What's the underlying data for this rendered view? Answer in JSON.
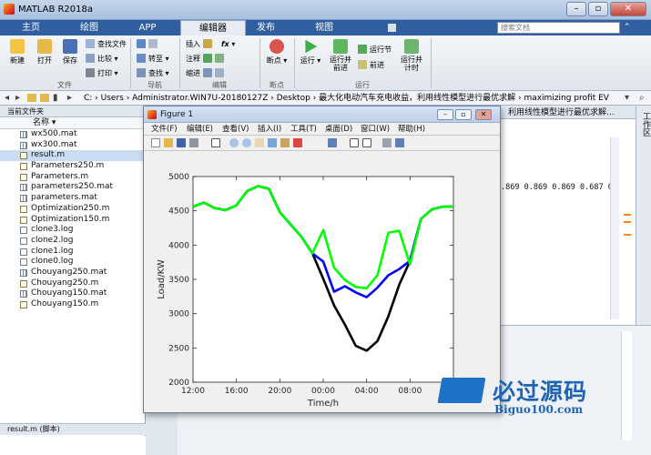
{
  "window": {
    "title": "MATLAB R2018a"
  },
  "tabs": [
    "主页",
    "绘图",
    "APP",
    "编辑器",
    "发布",
    "视图"
  ],
  "search": {
    "placeholder": "搜索文档"
  },
  "ribbon": {
    "file": {
      "new": "新建",
      "open": "打开",
      "save": "保存",
      "find_files": "查找文件",
      "compare": "比较",
      "print": "打印",
      "group": "文件"
    },
    "navigate": {
      "goto": "转至",
      "find": "查找",
      "group": "导航"
    },
    "edit": {
      "insert": "插入",
      "comment": "注释",
      "indent": "缩进",
      "fx": "fx",
      "group": "编辑"
    },
    "breakpoints": {
      "label": "断点",
      "group": "断点"
    },
    "run": {
      "run": "运行",
      "run_advance": "运行并\n前进",
      "run_section": "运行节",
      "advance": "前进",
      "run_time": "运行并\n计时",
      "group": "运行"
    }
  },
  "address": {
    "path": "C: › Users › Administrator.WIN7U-20180127Z › Desktop › 最大化电动汽车充电收益，利用线性模型进行最优求解 › maximizing profit EV"
  },
  "left_panel": {
    "header": "当前文件夹",
    "col_name": "名称",
    "files": [
      {
        "name": "wx500.mat",
        "type": "mat"
      },
      {
        "name": "wx300.mat",
        "type": "mat"
      },
      {
        "name": "result.m",
        "type": "m",
        "selected": true
      },
      {
        "name": "Parameters250.m",
        "type": "m"
      },
      {
        "name": "Parameters.m",
        "type": "m"
      },
      {
        "name": "parameters250.mat",
        "type": "mat"
      },
      {
        "name": "parameters.mat",
        "type": "mat"
      },
      {
        "name": "Optimization250.m",
        "type": "m"
      },
      {
        "name": "Optimization150.m",
        "type": "m"
      },
      {
        "name": "clone3.log",
        "type": "log"
      },
      {
        "name": "clone2.log",
        "type": "log"
      },
      {
        "name": "clone1.log",
        "type": "log"
      },
      {
        "name": "clone0.log",
        "type": "log"
      },
      {
        "name": "Chouyang250.mat",
        "type": "mat"
      },
      {
        "name": "Chouyang250.m",
        "type": "m"
      },
      {
        "name": "Chouyang150.mat",
        "type": "mat"
      },
      {
        "name": "Chouyang150.m",
        "type": "m"
      }
    ],
    "details": "result.m  (脚本)"
  },
  "right_panel": {
    "tab": "利用线性模型进行最优求解...",
    "side_label": "工作区",
    "values": ".869  0.869  0.869  0.687  0."
  },
  "figure": {
    "title": "Figure 1",
    "menu": [
      "文件(F)",
      "编辑(E)",
      "查看(V)",
      "插入(I)",
      "工具(T)",
      "桌面(D)",
      "窗口(W)",
      "帮助(H)"
    ]
  },
  "chart_data": {
    "type": "line",
    "xlabel": "Time/h",
    "ylabel": "Load/KW",
    "ylim": [
      2000,
      5000
    ],
    "yticks": [
      2000,
      2500,
      3000,
      3500,
      4000,
      4500,
      5000
    ],
    "x_ticks": [
      "12:00",
      "16:00",
      "20:00",
      "00:00",
      "04:00",
      "08:00"
    ],
    "x_tick_hours": [
      0,
      4,
      8,
      12,
      16,
      20
    ],
    "x": [
      0,
      1,
      2,
      3,
      4,
      5,
      6,
      7,
      8,
      9,
      10,
      11,
      12,
      13,
      14,
      15,
      16,
      17,
      18,
      19,
      20,
      21,
      22,
      23,
      24
    ],
    "series": [
      {
        "color": "#000000",
        "values": [
          4560,
          4620,
          4540,
          4510,
          4580,
          4790,
          4860,
          4820,
          4480,
          4300,
          4120,
          3880,
          3510,
          3120,
          2840,
          2530,
          2460,
          2600,
          2960,
          3420,
          3770,
          4380,
          4520,
          4560,
          4560
        ]
      },
      {
        "color": "#0000ff",
        "values": [
          4560,
          4620,
          4540,
          4510,
          4580,
          4790,
          4860,
          4820,
          4480,
          4300,
          4120,
          3880,
          3760,
          3320,
          3400,
          3310,
          3240,
          3380,
          3560,
          3650,
          3770,
          4380,
          4520,
          4560,
          4560
        ]
      },
      {
        "color": "#00ff00",
        "values": [
          4560,
          4620,
          4540,
          4510,
          4580,
          4790,
          4860,
          4820,
          4480,
          4300,
          4120,
          3880,
          4220,
          3670,
          3490,
          3390,
          3370,
          3560,
          4180,
          4210,
          3720,
          4380,
          4520,
          4560,
          4560
        ]
      }
    ]
  },
  "watermark": {
    "brand": "必过源码",
    "url": "Biguo100.com"
  }
}
